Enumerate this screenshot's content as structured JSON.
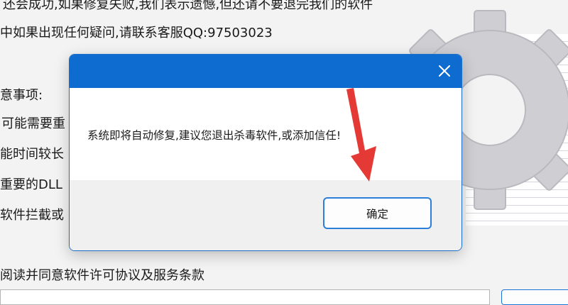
{
  "background": {
    "lines": [
      "还会成功,如果修复失败,我们表示遗憾,但还请不要退完我们的软件",
      "中如果出现任何疑问,请联系客服QQ:97503023",
      "意事项:",
      " 可能需要重",
      "能时间较长",
      "重要的DLL",
      "软件拦截或",
      "阅读并同意软件许可协议及服务条款"
    ]
  },
  "dialog": {
    "message": "系统即将自动修复,建议您退出杀毒软件,或添加信任!",
    "ok_label": "确定",
    "close_icon": "close-icon",
    "annotation_icon": "red-arrow-icon",
    "colors": {
      "titlebar": "#0e6bd0",
      "footer": "#f0f0f0",
      "button_border": "#2b7fd8",
      "arrow": "#e53935"
    }
  }
}
